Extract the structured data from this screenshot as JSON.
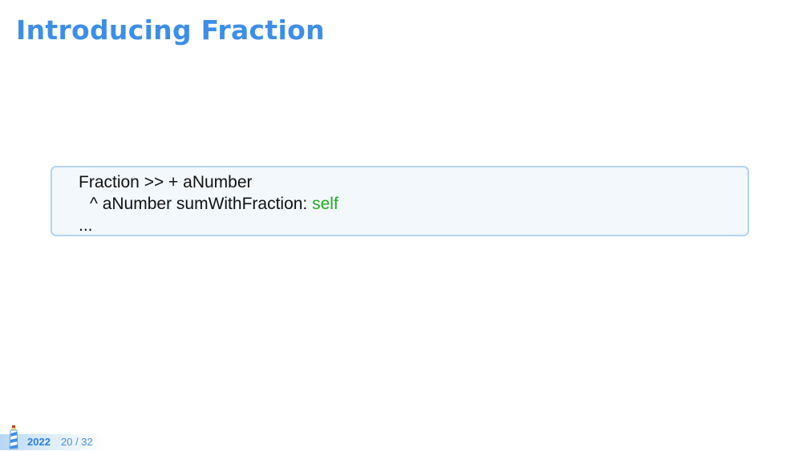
{
  "slide": {
    "title": "Introducing Fraction"
  },
  "code": {
    "line1": "Fraction >> + aNumber",
    "line2_prefix": "^ aNumber sumWithFraction: ",
    "line2_keyword": "self",
    "line3": "..."
  },
  "footer": {
    "year": "2022",
    "page": "20 / 32"
  },
  "colors": {
    "title": "#3d8ee8",
    "code_box_border": "#b3d3f3",
    "code_box_background": "#f3f8fd",
    "keyword_self": "#1faa1f",
    "footer_text": "#2e7fd6"
  },
  "icons": [
    "lighthouse-logo-icon"
  ]
}
